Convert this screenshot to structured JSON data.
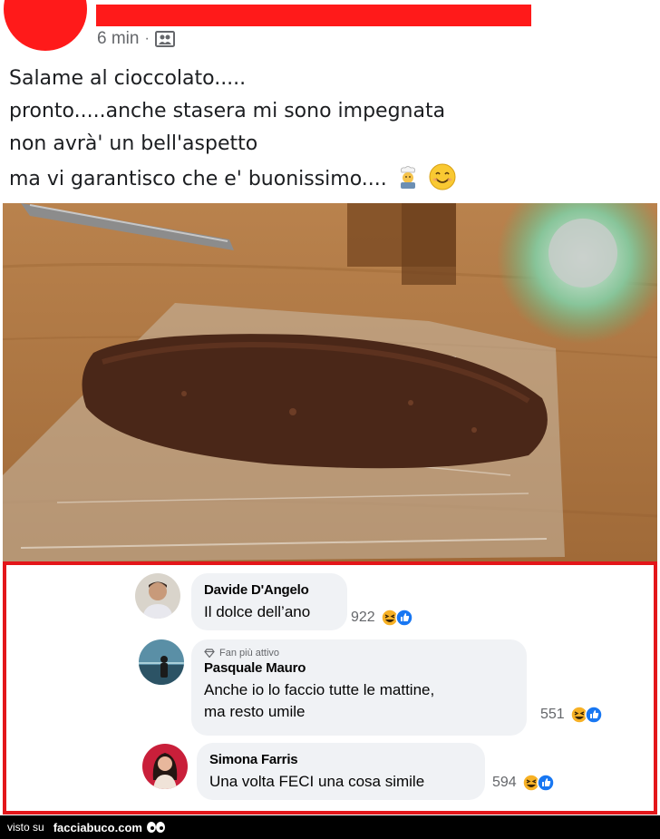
{
  "post": {
    "timestamp": "6 min",
    "separator": "·",
    "audience_icon": "friends-icon",
    "lines": [
      "Salame al cioccolato.....",
      "pronto.....anche stasera mi sono impegnata",
      "non avrà' un bell'aspetto",
      "ma vi garantisco che e' buonissimo...."
    ],
    "line_emojis": [
      "chef-emoji",
      "smiling-face-emoji"
    ]
  },
  "comments": [
    {
      "author": "Davide D'Angelo",
      "badge": "",
      "lines": [
        "Il dolce dell’ano"
      ],
      "reaction_count": "922",
      "reactions": [
        "haha-icon",
        "like-icon"
      ]
    },
    {
      "author": "Pasquale Mauro",
      "badge": "Fan più attivo",
      "lines": [
        "Anche io lo faccio tutte le mattine,",
        "ma resto umile"
      ],
      "reaction_count": "551",
      "reactions": [
        "haha-icon",
        "like-icon"
      ]
    },
    {
      "author": "Simona Farris",
      "badge": "",
      "lines": [
        "Una volta FECI una cosa simile"
      ],
      "reaction_count": "594",
      "reactions": [
        "haha-icon",
        "like-icon"
      ]
    }
  ],
  "footer": {
    "prefix": "visto su",
    "site": "facciabuco.com"
  },
  "colors": {
    "redaction": "#ff1a1a",
    "highlight_border": "#e3161a",
    "bubble": "#f0f2f5",
    "like_blue": "#1877f2",
    "haha_yellow": "#f7b125"
  }
}
